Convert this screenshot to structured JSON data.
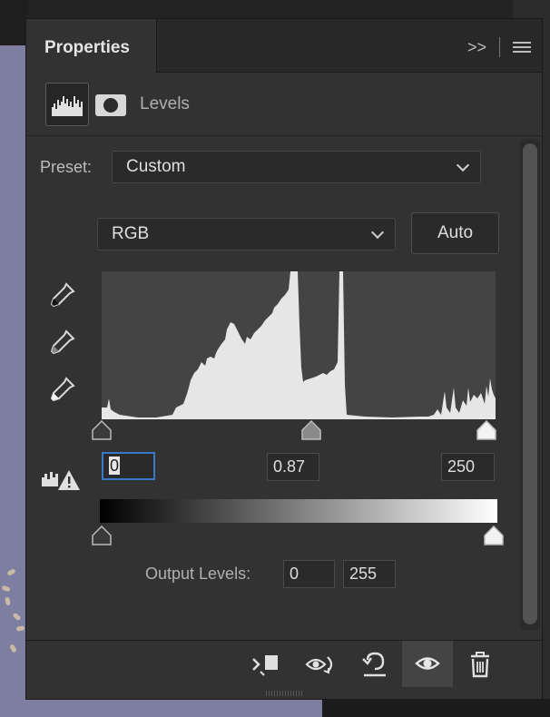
{
  "panel": {
    "tab_title": "Properties",
    "adjustment_label": "Levels",
    "expand_glyph": ">>"
  },
  "preset": {
    "label": "Preset:",
    "value": "Custom"
  },
  "channel": {
    "value": "RGB"
  },
  "auto_button": {
    "label": "Auto"
  },
  "input_levels": {
    "black": "0",
    "gamma": "0.87",
    "white": "250"
  },
  "output_levels": {
    "label": "Output Levels:",
    "black": "0",
    "white": "255"
  },
  "histogram": {
    "range": [
      0,
      255
    ],
    "input_black": 0,
    "input_gamma_position": 0.53,
    "input_white": 250,
    "output_black": 0,
    "output_white": 255
  },
  "colors": {
    "panel_bg": "#323232",
    "histogram_bg": "#444444",
    "histogram_fill": "#e6e6e6",
    "active_field_border": "#3a78c8",
    "canvas_bg": "#7e7fa0"
  },
  "icons": [
    "histogram-icon",
    "mask-icon",
    "black-eyedropper-icon",
    "gray-eyedropper-icon",
    "white-eyedropper-icon",
    "clipping-warning-icon",
    "clip-to-layer-icon",
    "view-previous-state-icon",
    "reset-icon",
    "visibility-eye-icon",
    "trash-icon",
    "panel-menu-icon",
    "collapse-panel-icon"
  ]
}
